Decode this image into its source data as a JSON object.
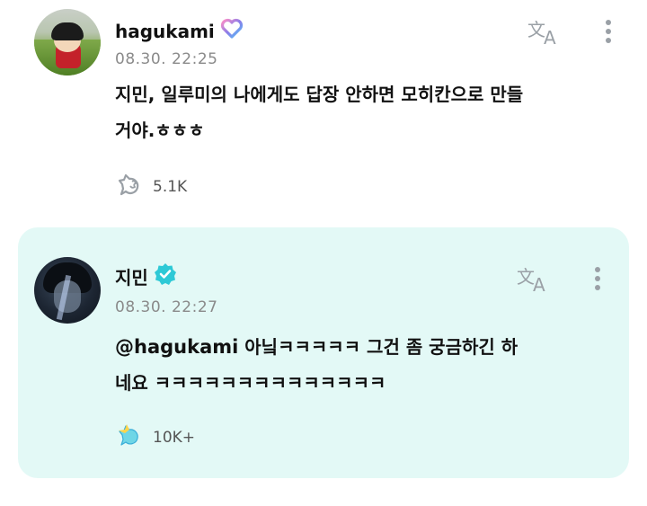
{
  "post": {
    "username": "hagukami",
    "timestamp": "08.30. 22:25",
    "text_line1": "지민, 일루미의 나에게도 답장 안하면 모히칸으로 만들",
    "text_line2": "거야.ㅎㅎㅎ",
    "reaction_count": "5.1K",
    "badge_icon": "heart-outline-icon",
    "badge_color": "#8c7ce8"
  },
  "reply": {
    "username": "지민",
    "timestamp": "08.30. 22:27",
    "mention": "@hagukami",
    "text_line1_rest": " 아닠ㅋㅋㅋㅋㅋ 그건 좀 궁금하긴 하",
    "text_line2": "네요 ㅋㅋㅋㅋㅋㅋㅋㅋㅋㅋㅋㅋㅋㅋ",
    "reaction_count": "10K+",
    "badge_icon": "verified-check-icon",
    "badge_color": "#2ec9d6",
    "card_color": "#e3f9f6"
  }
}
